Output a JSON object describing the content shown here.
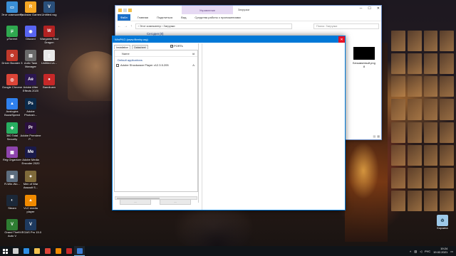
{
  "desktop": {
    "icons": [
      {
        "label": "Этот компьютер",
        "icon": "computer-icon",
        "color": "#3b8fd6",
        "glyph": "▭"
      },
      {
        "label": "Rockstar Games ...",
        "icon": "rockstar-icon",
        "color": "#f5a623",
        "glyph": "R"
      },
      {
        "label": "Untitled.vsg",
        "icon": "vegas-file-icon",
        "color": "#2a4f7a",
        "glyph": "V"
      },
      {
        "label": "μTorrent",
        "icon": "utorrent-icon",
        "color": "#2fa84f",
        "glyph": "μ"
      },
      {
        "label": "Discord",
        "icon": "discord-icon",
        "color": "#5865f2",
        "glyph": "◉"
      },
      {
        "label": "Wargame Red Dragon",
        "icon": "wargame-icon",
        "color": "#b22222",
        "glyph": "W"
      },
      {
        "label": "Driver Booster 3",
        "icon": "driver-booster-icon",
        "color": "#c0392b",
        "glyph": "⚙"
      },
      {
        "label": "Antiv Task Manager",
        "icon": "task-manager-icon",
        "color": "#6a6a6a",
        "glyph": "▤"
      },
      {
        "label": "Untitled.vs...",
        "icon": "document-icon",
        "color": "#e8e8e8",
        "glyph": "▯"
      },
      {
        "label": "Google Chrome",
        "icon": "chrome-icon",
        "color": "#db4437",
        "glyph": "◎"
      },
      {
        "label": "Adobe After Effects 2020",
        "icon": "after-effects-icon",
        "color": "#2b1650",
        "glyph": "Ae"
      },
      {
        "label": "Bandicam",
        "icon": "bandicam-icon",
        "color": "#c62828",
        "glyph": "●"
      },
      {
        "label": "Auslogics BoostSpeed",
        "icon": "boostspeed-icon",
        "color": "#2f80ed",
        "glyph": "▲"
      },
      {
        "label": "Adobe Photosh...",
        "icon": "photoshop-icon",
        "color": "#0b2a4a",
        "glyph": "Ps"
      },
      {
        "label": "360 Total Security",
        "icon": "security-icon",
        "color": "#27ae60",
        "glyph": "✚"
      },
      {
        "label": "Adobe Premiere P...",
        "icon": "premiere-icon",
        "color": "#2a0f3e",
        "glyph": "Pr"
      },
      {
        "label": "Reg Organizer",
        "icon": "reg-organizer-icon",
        "color": "#8e44ad",
        "glyph": "▦"
      },
      {
        "label": "Adobe Media Encoder 2020",
        "icon": "media-encoder-icon",
        "color": "#1a1a4a",
        "glyph": "Me"
      },
      {
        "label": "R-Win-Wu...",
        "icon": "app-icon",
        "color": "#5d6d7e",
        "glyph": "▣"
      },
      {
        "label": "Men of War Assault S...",
        "icon": "men-of-war-icon",
        "color": "#7f6a3a",
        "glyph": "✦"
      },
      {
        "label": "Steam",
        "icon": "steam-icon",
        "color": "#1b2838",
        "glyph": "◐"
      },
      {
        "label": "VLC media player",
        "icon": "vlc-icon",
        "color": "#f08a00",
        "glyph": "▲"
      },
      {
        "label": "Grand Theft Auto V",
        "icon": "gta-icon",
        "color": "#2e7d32",
        "glyph": "V"
      },
      {
        "label": "VEGAS Pro 15.0",
        "icon": "vegas-icon",
        "color": "#1e3a5f",
        "glyph": "V"
      }
    ],
    "recycle_bin_label": "Корзина"
  },
  "explorer": {
    "manage_label": "Управление",
    "title": "Загрузки",
    "tabs": [
      "Файл",
      "Главная",
      "Поделиться",
      "Вид",
      "Средства работы с приложениями"
    ],
    "path": "› Этот компьютер › Загрузки",
    "search_placeholder": "Поиск: Загрузки",
    "group_label": "Сегодня (8)",
    "file_name": "Безымянный.png",
    "file_size": "8",
    "ctrl_min": "─",
    "ctrl_max": "☐",
    "ctrl_close": "✕"
  },
  "winpkg": {
    "title": "WinPKG (www.fileeby.org)",
    "tabs": [
      "Installation",
      "Datasheet"
    ],
    "checkbox_label": "PORTs",
    "checkbox_mark": "✓",
    "col_name": "Name",
    "col_id": "id",
    "group": "Default applications",
    "items": [
      {
        "name": "Adobe Shockwave Player v12.3.5.205",
        "version": "A."
      }
    ],
    "close_glyph": "✕",
    "button_left": "—",
    "button_right": "—"
  },
  "taskbar": {
    "apps": [
      {
        "icon": "start-icon"
      },
      {
        "icon": "task-view-icon",
        "color": "#cfcfcf"
      },
      {
        "icon": "edge-icon",
        "color": "#2d8fe6"
      },
      {
        "icon": "file-explorer-icon",
        "color": "#f2c14e"
      },
      {
        "icon": "chrome-taskbar-icon",
        "color": "#db4437"
      },
      {
        "icon": "vlc-taskbar-icon",
        "color": "#f08a00"
      },
      {
        "icon": "bandicam-taskbar-icon",
        "color": "#c62828"
      },
      {
        "icon": "winpkg-taskbar-icon",
        "color": "#3a7bd5"
      }
    ],
    "language": "РУС",
    "time": "19:24",
    "date": "19.02.2021"
  }
}
